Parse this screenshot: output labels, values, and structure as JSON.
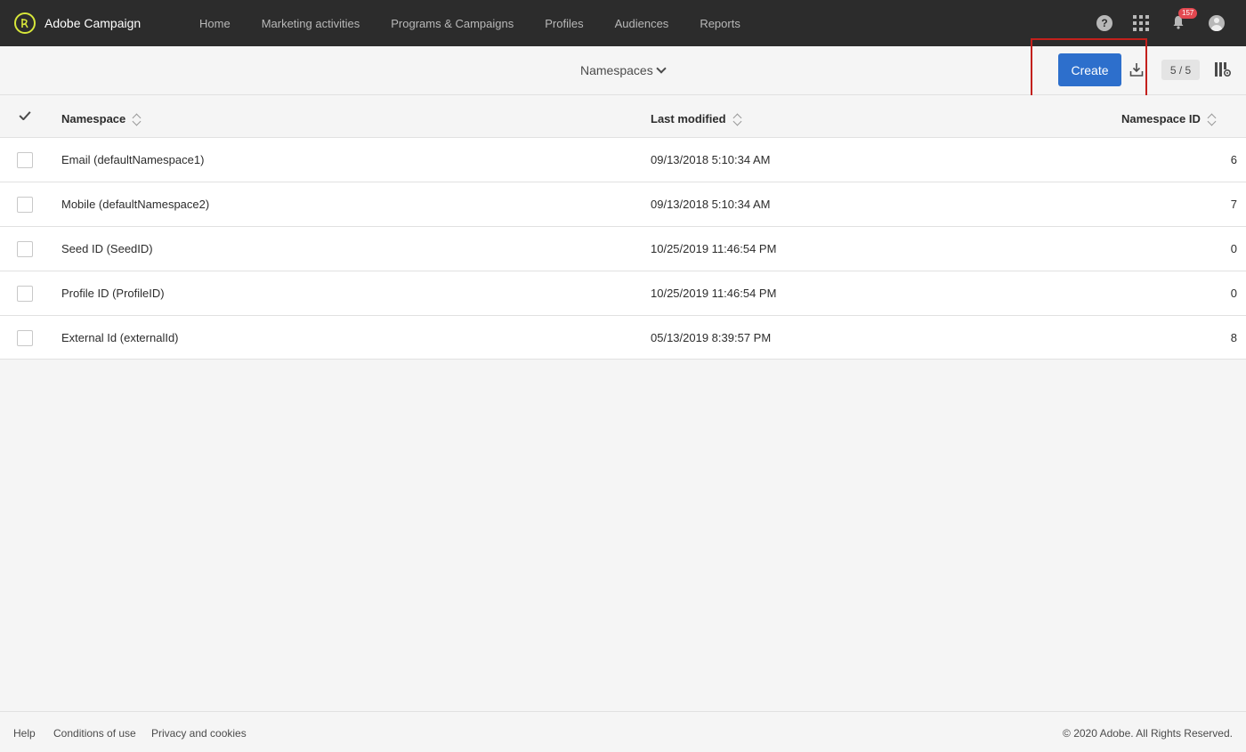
{
  "app": {
    "name": "Adobe Campaign",
    "nav": [
      "Home",
      "Marketing activities",
      "Programs & Campaigns",
      "Profiles",
      "Audiences",
      "Reports"
    ],
    "notifications_count": "157",
    "help_glyph": "?"
  },
  "actionbar": {
    "title": "Namespaces",
    "create_label": "Create",
    "count": "5 / 5"
  },
  "table": {
    "columns": [
      "Namespace",
      "Last modified",
      "Namespace ID"
    ],
    "rows": [
      {
        "namespace": "Email (defaultNamespace1)",
        "modified": "09/13/2018 5:10:34 AM",
        "id": "6"
      },
      {
        "namespace": "Mobile (defaultNamespace2)",
        "modified": "09/13/2018 5:10:34 AM",
        "id": "7"
      },
      {
        "namespace": "Seed ID (SeedID)",
        "modified": "10/25/2019 11:46:54 PM",
        "id": "0"
      },
      {
        "namespace": "Profile ID (ProfileID)",
        "modified": "10/25/2019 11:46:54 PM",
        "id": "0"
      },
      {
        "namespace": "External Id (externalId)",
        "modified": "05/13/2019 8:39:57 PM",
        "id": "8"
      }
    ]
  },
  "footer": {
    "links": [
      "Help",
      "Conditions of use",
      "Privacy and cookies"
    ],
    "copyright": "© 2020 Adobe. All Rights Reserved."
  },
  "colors": {
    "topbar": "#2c2c2c",
    "accent_button": "#2d6fcc",
    "highlight_border": "#c3201c",
    "badge": "#e34850",
    "logo": "#d7e63a"
  },
  "icons": [
    "adobe-campaign-logo-icon",
    "help-icon",
    "apps-grid-icon",
    "bell-icon",
    "avatar-icon",
    "chevron-down-icon",
    "download-icon",
    "column-settings-icon",
    "check-icon",
    "sort-icon"
  ]
}
